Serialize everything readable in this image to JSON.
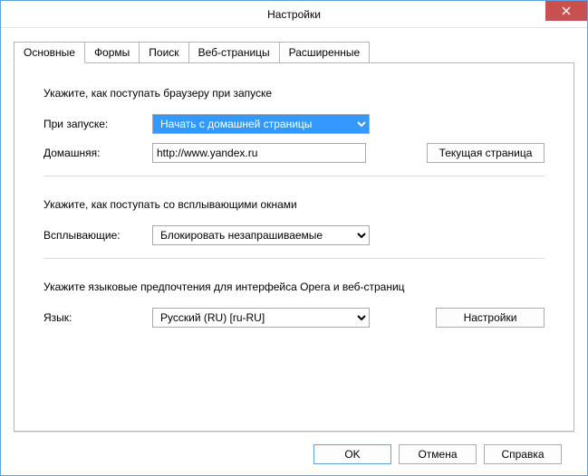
{
  "window": {
    "title": "Настройки"
  },
  "tabs": [
    {
      "label": "Основные"
    },
    {
      "label": "Формы"
    },
    {
      "label": "Поиск"
    },
    {
      "label": "Веб-страницы"
    },
    {
      "label": "Расширенные"
    }
  ],
  "startup": {
    "desc": "Укажите, как поступать браузеру при запуске",
    "on_start_label": "При запуске:",
    "on_start_value": "Начать с домашней страницы",
    "homepage_label": "Домашняя:",
    "homepage_value": "http://www.yandex.ru",
    "current_page_btn": "Текущая страница"
  },
  "popups": {
    "desc": "Укажите, как поступать со всплывающими окнами",
    "label": "Всплывающие:",
    "value": "Блокировать незапрашиваемые"
  },
  "language": {
    "desc": "Укажите языковые предпочтения для интерфейса Opera и веб-страниц",
    "label": "Язык:",
    "value": "Русский (RU) [ru-RU]",
    "settings_btn": "Настройки"
  },
  "footer": {
    "ok": "OK",
    "cancel": "Отмена",
    "help": "Справка"
  }
}
